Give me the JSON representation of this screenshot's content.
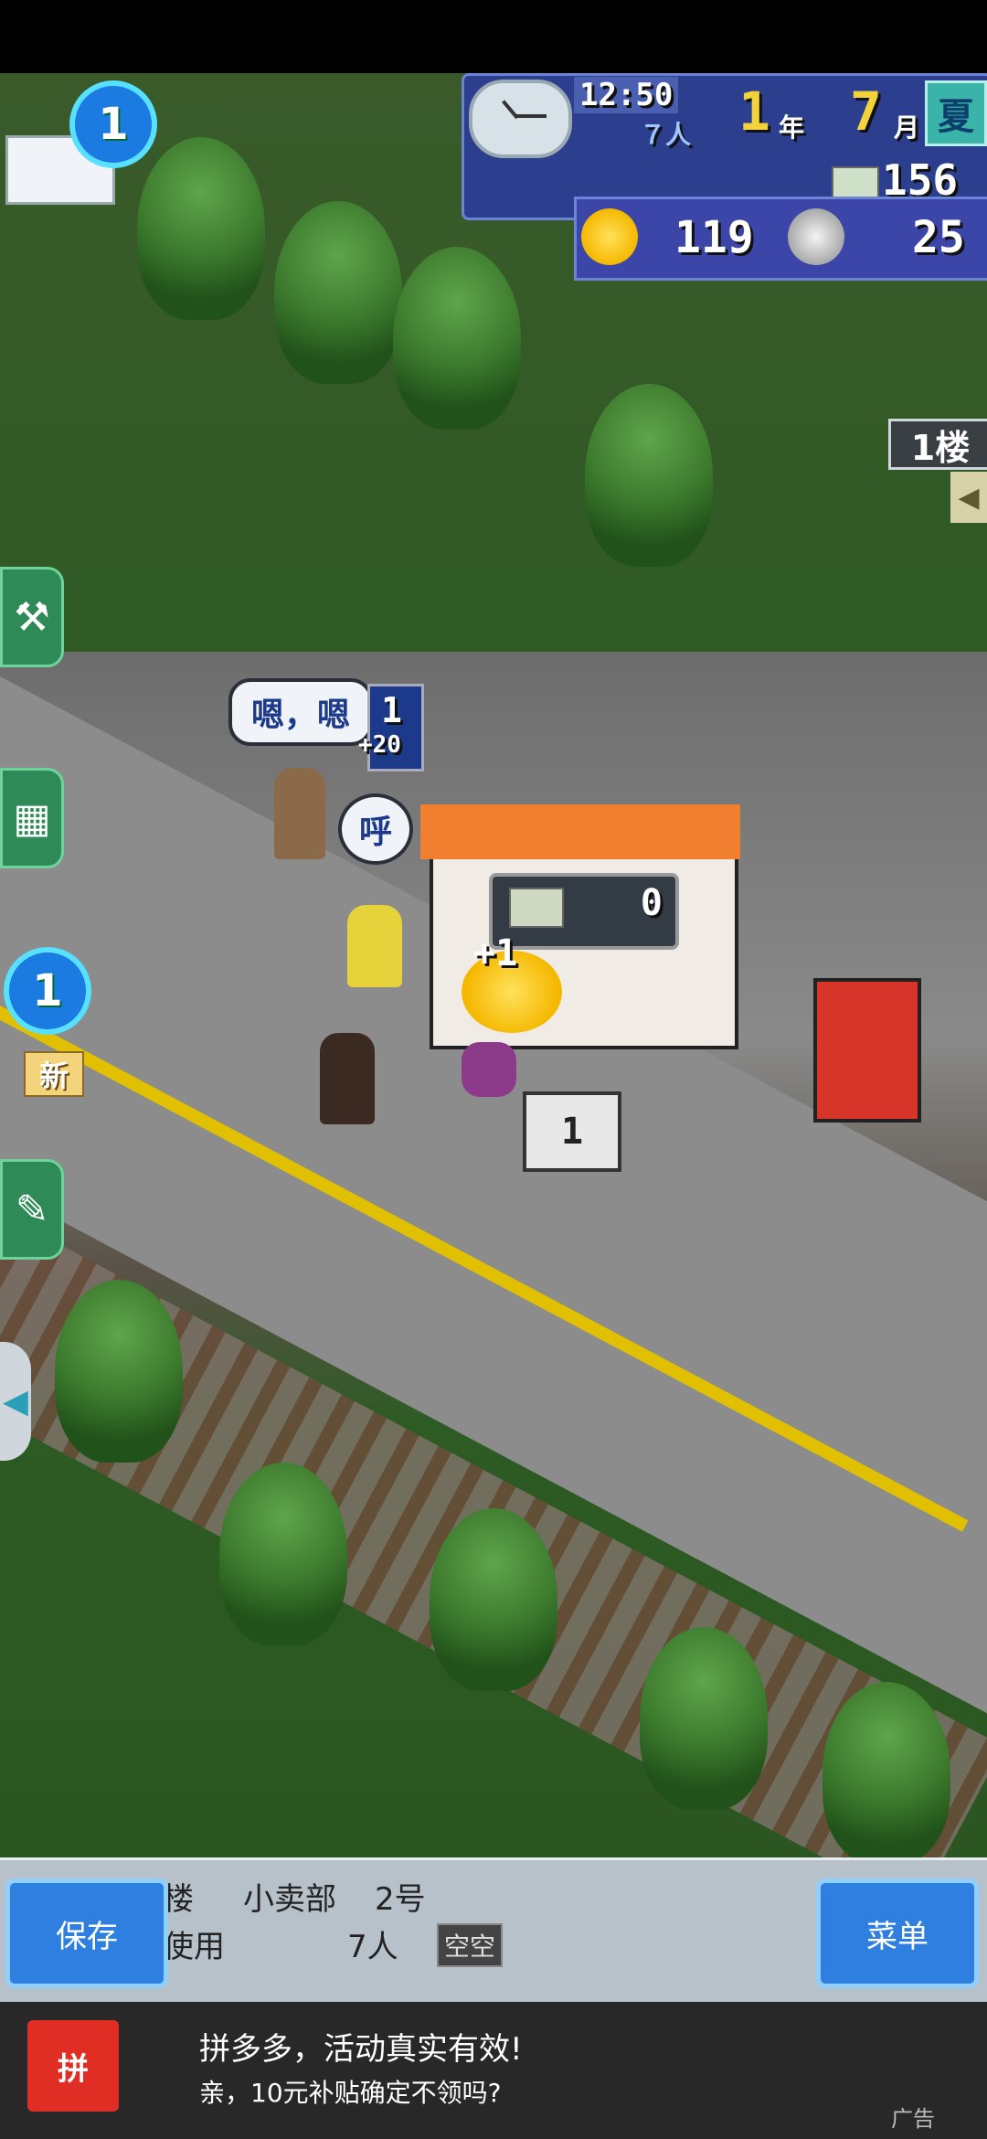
{
  "hud": {
    "time": "12:50",
    "weather": "７人",
    "year_num": "1",
    "year_unit": "年",
    "month_num": "7",
    "month_unit": "月",
    "season": "夏",
    "money": "156",
    "idea_points": "119",
    "coin_points": "25"
  },
  "mail": {
    "badge": "1"
  },
  "left_badge": "1",
  "left_new": "新",
  "floor": {
    "label": "1楼",
    "arrow": "◀"
  },
  "bubbles": {
    "chat": "嗯，嗯",
    "sigh": "呼",
    "score_num": "1",
    "score_plus": "+20"
  },
  "shop": {
    "money_amount": "0",
    "plus_one": "+1",
    "sign_num": "1"
  },
  "info": {
    "line1_floor": "楼",
    "line1_name": "小卖部",
    "line1_no": "2号",
    "line2_use": "使用",
    "line2_people": "7人",
    "line2_chip": "空空"
  },
  "buttons": {
    "save": "保存",
    "menu": "菜单"
  },
  "ad": {
    "logo": "拼",
    "title": "拼多多，活动真实有效!",
    "subtitle": "亲，10元补贴确定不领吗?",
    "tag": "广告"
  }
}
